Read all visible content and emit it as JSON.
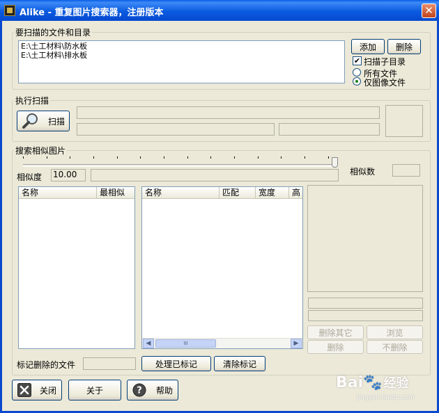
{
  "window": {
    "title": "Alike - 重复图片搜索器，注册版本",
    "close_glyph": "✕"
  },
  "scan_targets": {
    "legend": "要扫描的文件和目录",
    "paths": [
      "E:\\土工材料\\防水板",
      "E:\\土工材料\\排水板"
    ],
    "add_label": "添加",
    "delete_label": "删除",
    "subdirs_label": "扫描子目录",
    "subdirs_checked": true,
    "all_files_label": "所有文件",
    "images_only_label": "仅图像文件",
    "selected_filter": "images_only"
  },
  "execute": {
    "legend": "执行扫描",
    "scan_label": "扫描"
  },
  "search": {
    "legend": "搜索相似图片",
    "similarity_label": "相似度",
    "similarity_value": "10.00",
    "similar_count_label": "相似数",
    "slider_level": 1.0
  },
  "list_left": {
    "columns": [
      "名称",
      "最相似"
    ]
  },
  "list_right": {
    "columns": [
      "名称",
      "匹配",
      "宽度",
      "高"
    ],
    "scroll_grip": "III"
  },
  "side_buttons": {
    "delete_others": "删除其它",
    "browse": "浏览",
    "delete": "删除",
    "no_delete": "不删除"
  },
  "marked": {
    "label": "标记删除的文件",
    "process_label": "处理已标记",
    "clear_label": "清除标记"
  },
  "bottom": {
    "close_label": "关闭",
    "about_label": "关于",
    "help_label": "帮助"
  },
  "watermark": {
    "brand": "Bai",
    "brand2": "经验",
    "url": "jingyan.baidu.com"
  }
}
